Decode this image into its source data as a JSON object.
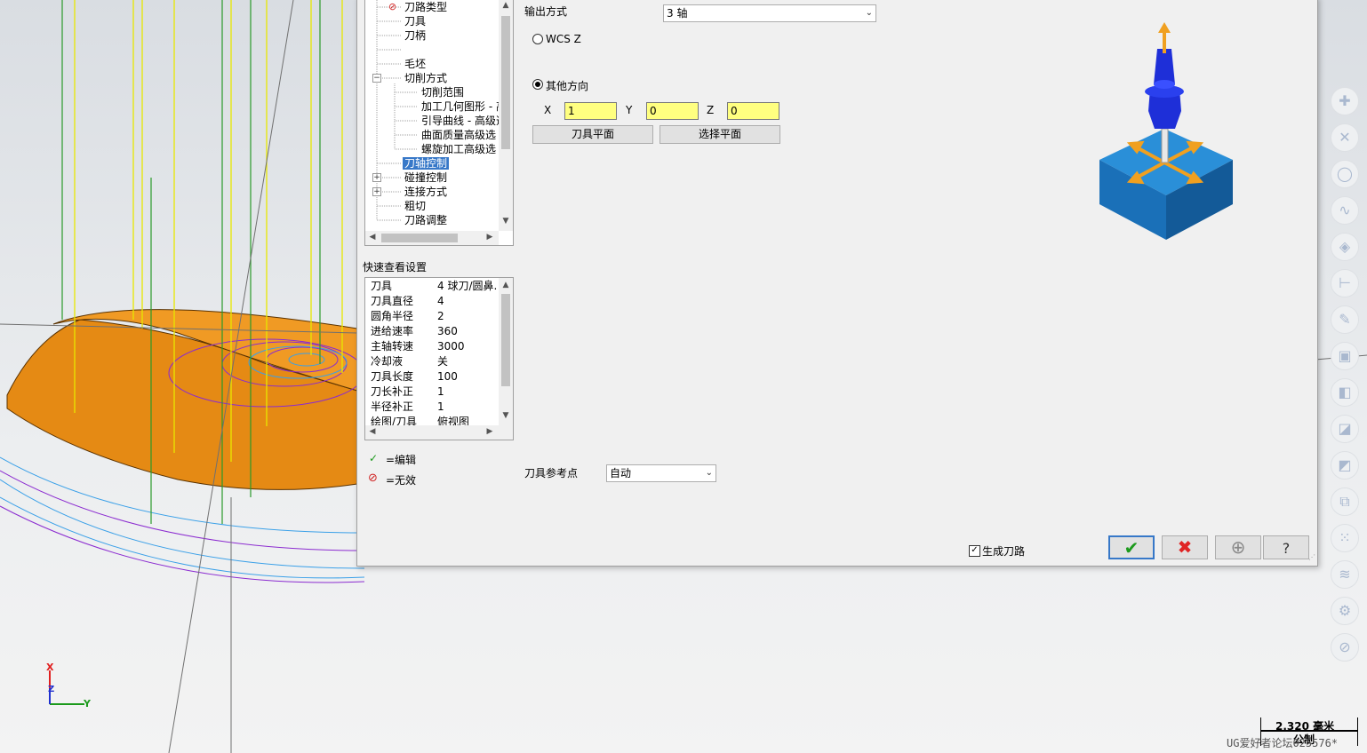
{
  "tree": {
    "items": [
      {
        "label": "刀路类型"
      },
      {
        "label": "刀具"
      },
      {
        "label": "刀柄"
      },
      {
        "label": ""
      },
      {
        "label": "毛坯"
      },
      {
        "label": "切削方式"
      },
      {
        "label": "切削范围"
      },
      {
        "label": "加工几何图形 - 高"
      },
      {
        "label": "引导曲线 - 高级选"
      },
      {
        "label": "曲面质量高级选"
      },
      {
        "label": "螺旋加工高级选"
      },
      {
        "label": "刀轴控制"
      },
      {
        "label": "碰撞控制"
      },
      {
        "label": "连接方式"
      },
      {
        "label": "粗切"
      },
      {
        "label": "刀路调整"
      }
    ]
  },
  "quick_view": {
    "title": "快速查看设置",
    "rows": [
      {
        "key": "刀具",
        "value": "4 球刀/圆鼻."
      },
      {
        "key": "刀具直径",
        "value": "4"
      },
      {
        "key": "圆角半径",
        "value": "2"
      },
      {
        "key": "进给速率",
        "value": "360"
      },
      {
        "key": "主轴转速",
        "value": "3000"
      },
      {
        "key": "冷却液",
        "value": "关"
      },
      {
        "key": "刀具长度",
        "value": "100"
      },
      {
        "key": "刀长补正",
        "value": "1"
      },
      {
        "key": "半径补正",
        "value": "1"
      },
      {
        "key": "绘图/刀具",
        "value": "俯视图"
      }
    ]
  },
  "legend": {
    "edit_label": "=编辑",
    "invalid_label": "=无效"
  },
  "output": {
    "label": "输出方式",
    "value": "3 轴"
  },
  "radio": {
    "wcs_label": "WCS Z",
    "other_label": "其他方向",
    "selected": "other"
  },
  "vector": {
    "x_label": "X",
    "x_value": "1",
    "y_label": "Y",
    "y_value": "0",
    "z_label": "Z",
    "z_value": "0"
  },
  "buttons": {
    "tool_plane": "刀具平面",
    "select_plane": "选择平面"
  },
  "reference": {
    "label": "刀具参考点",
    "value": "自动"
  },
  "footer": {
    "generate_label": "生成刀路",
    "generate_checked": true
  },
  "viewport": {
    "axis_x": "X",
    "axis_y": "Y",
    "axis_z": "Z",
    "scale_value": "2.320 毫米",
    "scale_unit": "公制",
    "watermark": "UG爱好者论坛025576*"
  },
  "colors": {
    "part": "#e58a14",
    "tool_blue": "#1e2fd8",
    "ok_green": "#1c9a1c",
    "cancel_red": "#e02424",
    "selection": "#3778c8"
  }
}
